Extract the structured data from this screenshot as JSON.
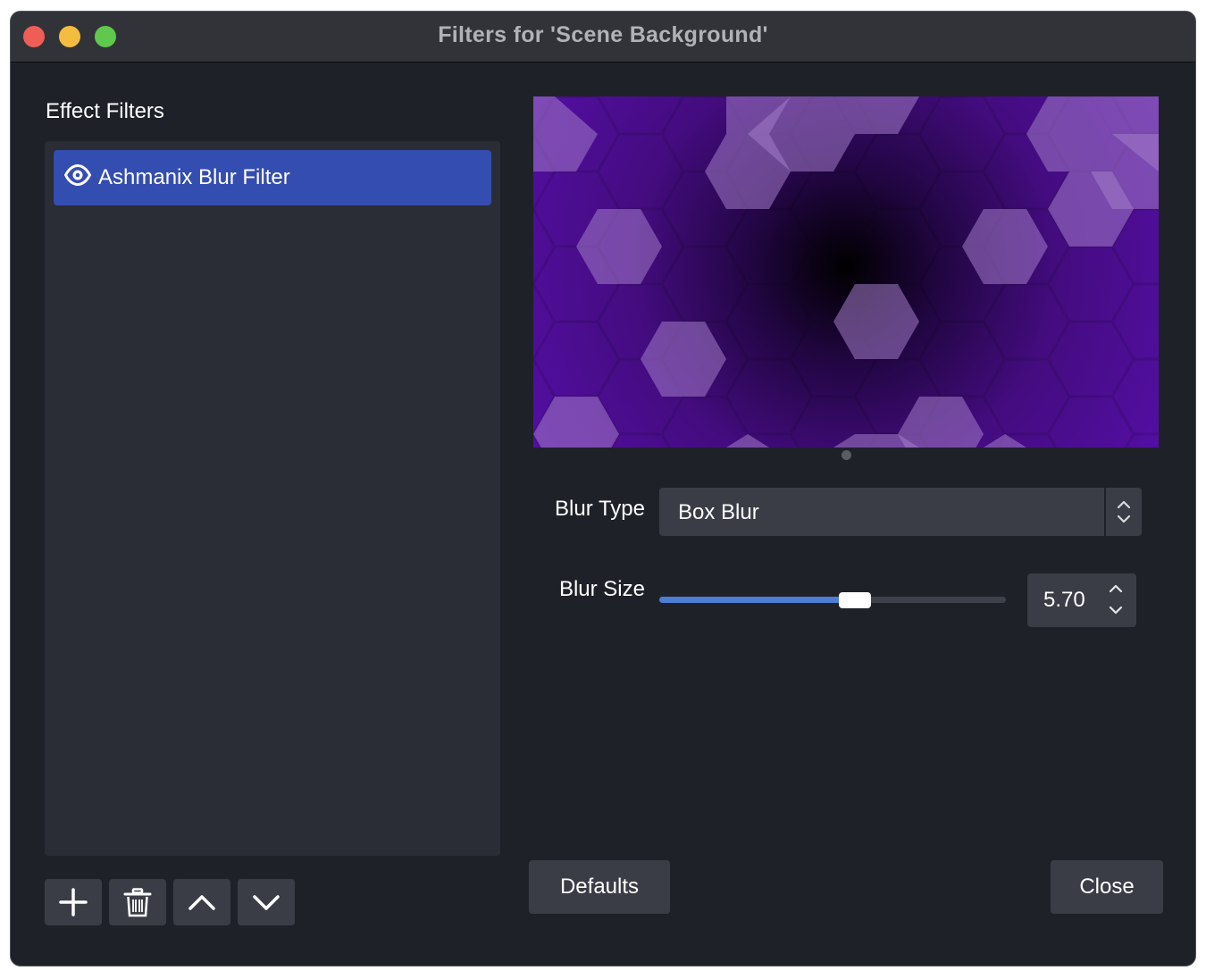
{
  "window": {
    "title": "Filters for 'Scene Background'"
  },
  "left_panel": {
    "section_label": "Effect Filters",
    "filters": [
      {
        "name": "Ashmanix Blur Filter",
        "visible": true,
        "selected": true
      }
    ],
    "toolbar": {
      "add_icon": "plus-icon",
      "remove_icon": "trash-icon",
      "move_up_icon": "chevron-up-icon",
      "move_down_icon": "chevron-down-icon"
    }
  },
  "properties": {
    "blur_type": {
      "label": "Blur Type",
      "value": "Box Blur"
    },
    "blur_size": {
      "label": "Blur Size",
      "value": "5.70",
      "slider_fraction": 0.565
    }
  },
  "buttons": {
    "defaults": "Defaults",
    "close": "Close"
  },
  "colors": {
    "accent": "#344db0",
    "slider_fill": "#4c7ed6",
    "window_bg": "#1f2129",
    "panel_bg": "#2a2d36",
    "control_bg": "#3b3d46"
  }
}
